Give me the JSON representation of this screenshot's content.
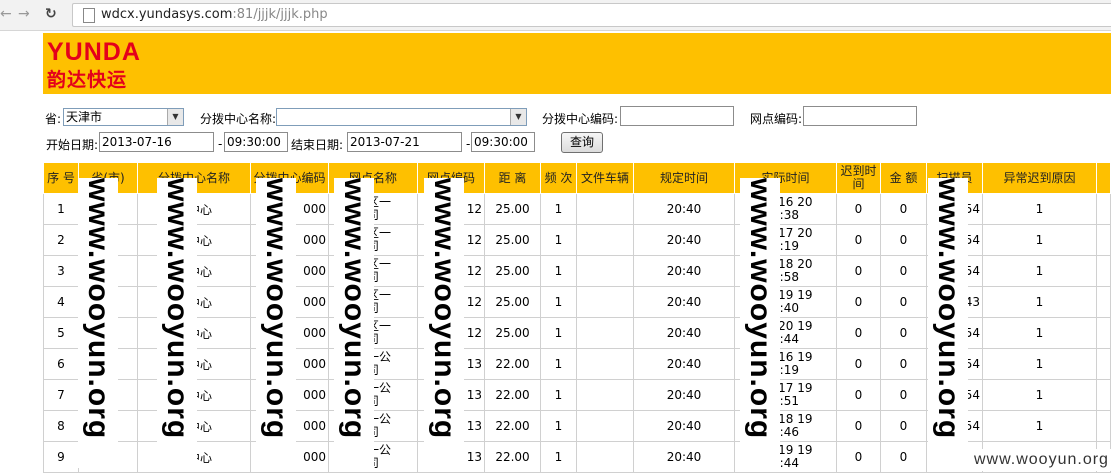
{
  "browser": {
    "url_host": "wdcx.yundasys.com",
    "url_rest": ":81/jjjk/jjjk.php"
  },
  "logo": {
    "en": "YUNDA",
    "cn": "韵达快运"
  },
  "form": {
    "province_label": "省:",
    "province_value": "天津市",
    "center_name_label": "分拨中心名称:",
    "center_name_value": "",
    "center_code_label": "分拨中心编码:",
    "center_code_value": "",
    "outlet_code_label": "网点编码:",
    "outlet_code_value": "",
    "start_label": "开始日期:",
    "start_date": "2013-07-16",
    "start_time": "09:30:00",
    "end_label": "结束日期:",
    "end_date": "2013-07-21",
    "end_time": "09:30:00",
    "dash": "-",
    "query_button": "查询"
  },
  "table": {
    "headers": [
      "序 号",
      "省(市)",
      "分拨中心名称",
      "分拨中心编码",
      "网点名称",
      "网点编码",
      "距 离",
      "频 次",
      "文件车辆",
      "规定时间",
      "实际时间",
      "迟到时间",
      "金 额",
      "扫描员",
      "异常迟到原因"
    ],
    "rows": [
      {
        "no": "1",
        "prov": "市",
        "center": "拨中心",
        "code": "000",
        "name_a": "开区一",
        "name_b": "司",
        "ocode": "12",
        "dist": "25.00",
        "freq": "1",
        "truck": "",
        "plan": "20:40",
        "act_a": "07-16 20",
        "act_b": "5:38",
        "late": "0",
        "amt": "0",
        "scan": "54",
        "reason": "1"
      },
      {
        "no": "2",
        "prov": "市",
        "center": "拨中心",
        "code": "000",
        "name_a": "开区一",
        "name_b": "司",
        "ocode": "12",
        "dist": "25.00",
        "freq": "1",
        "truck": "",
        "plan": "20:40",
        "act_a": "07-17 20",
        "act_b": "0:19",
        "late": "0",
        "amt": "0",
        "scan": "54",
        "reason": "1"
      },
      {
        "no": "3",
        "prov": "市",
        "center": "拨中心",
        "code": "000",
        "name_a": "开区一",
        "name_b": "司",
        "ocode": "12",
        "dist": "25.00",
        "freq": "1",
        "truck": "",
        "plan": "20:40",
        "act_a": "07-18 20",
        "act_b": "3:58",
        "late": "0",
        "amt": "0",
        "scan": "54",
        "reason": "1"
      },
      {
        "no": "4",
        "prov": "市",
        "center": "拨中心",
        "code": "000",
        "name_a": "开区一",
        "name_b": "司",
        "ocode": "12",
        "dist": "25.00",
        "freq": "1",
        "truck": "",
        "plan": "20:40",
        "act_a": "07-19 19",
        "act_b": "5:40",
        "late": "0",
        "amt": "0",
        "scan": "43",
        "reason": "1"
      },
      {
        "no": "5",
        "prov": "市",
        "center": "拨中心",
        "code": "000",
        "name_a": "开区一",
        "name_b": "司",
        "ocode": "12",
        "dist": "25.00",
        "freq": "1",
        "truck": "",
        "plan": "20:40",
        "act_a": "07-20 19",
        "act_b": "9:44",
        "late": "0",
        "amt": "0",
        "scan": "54",
        "reason": "1"
      },
      {
        "no": "6",
        "prov": "市",
        "center": "拨中心",
        "code": "000",
        "name_a": "区一公",
        "name_b": "司",
        "ocode": "13",
        "dist": "22.00",
        "freq": "1",
        "truck": "",
        "plan": "20:40",
        "act_a": "07-16 19",
        "act_b": "5:19",
        "late": "0",
        "amt": "0",
        "scan": "54",
        "reason": "1"
      },
      {
        "no": "7",
        "prov": "市",
        "center": "拨中心",
        "code": "000",
        "name_a": "区一公",
        "name_b": "司",
        "ocode": "13",
        "dist": "22.00",
        "freq": "1",
        "truck": "",
        "plan": "20:40",
        "act_a": "07-17 19",
        "act_b": "4:51",
        "late": "0",
        "amt": "0",
        "scan": "54",
        "reason": "1"
      },
      {
        "no": "8",
        "prov": "市",
        "center": "拨中心",
        "code": "000",
        "name_a": "区一公",
        "name_b": "司",
        "ocode": "13",
        "dist": "22.00",
        "freq": "1",
        "truck": "",
        "plan": "20:40",
        "act_a": "07-18 19",
        "act_b": "3:46",
        "late": "0",
        "amt": "0",
        "scan": "54",
        "reason": "1"
      },
      {
        "no": "9",
        "prov": "市",
        "center": "拨中心",
        "code": "000",
        "name_a": "区一公",
        "name_b": "司",
        "ocode": "13",
        "dist": "22.00",
        "freq": "1",
        "truck": "",
        "plan": "20:40",
        "act_a": "07-19 19",
        "act_b": "0:44",
        "late": "0",
        "amt": "0",
        "scan": "43",
        "reason": "1"
      }
    ]
  },
  "watermark": {
    "text": "www.wooyun.org",
    "corner": "www.wooyun.org"
  }
}
